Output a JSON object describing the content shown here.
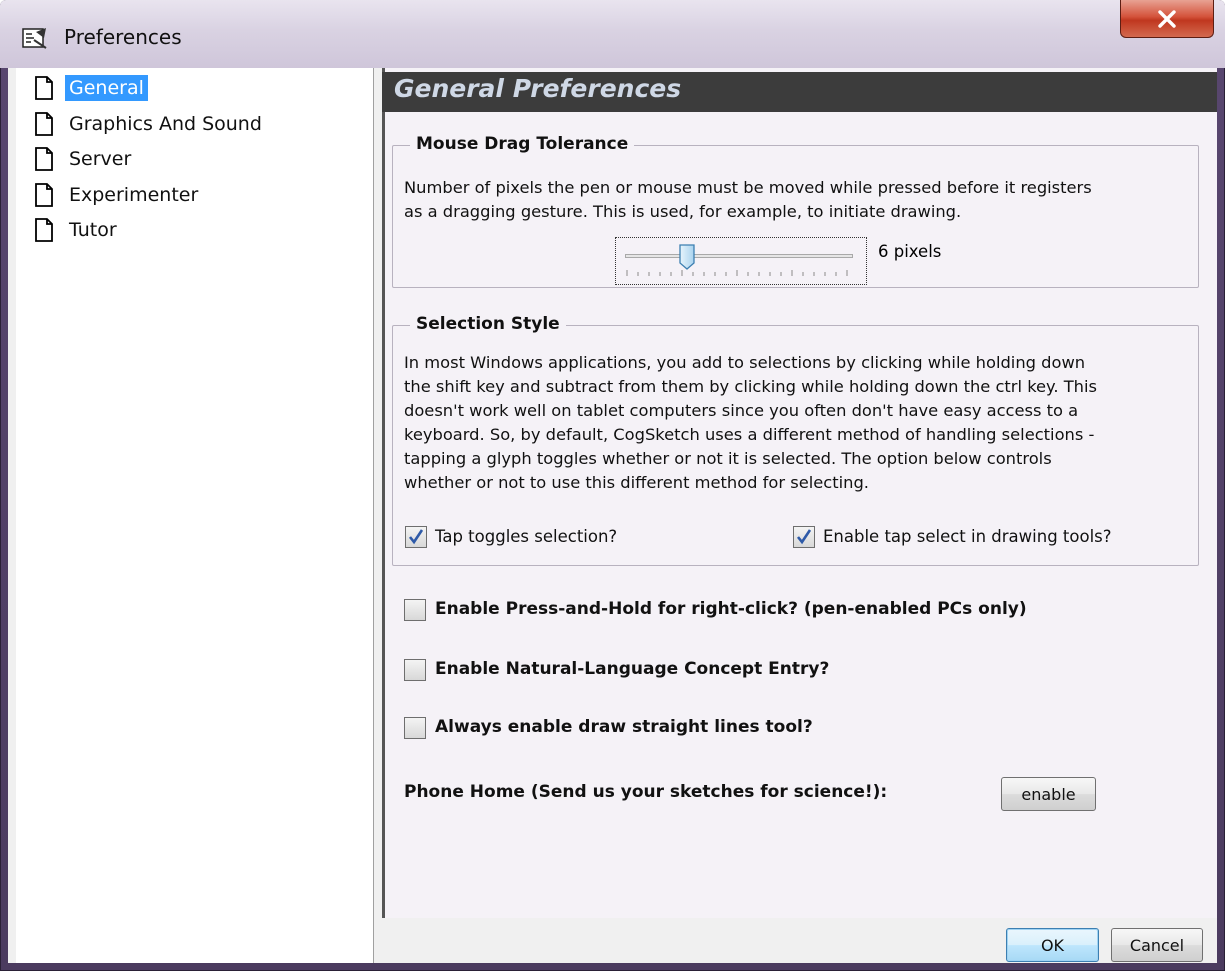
{
  "window": {
    "title": "Preferences"
  },
  "tree": {
    "items": [
      {
        "label": "General",
        "selected": true
      },
      {
        "label": "Graphics And Sound",
        "selected": false
      },
      {
        "label": "Server",
        "selected": false
      },
      {
        "label": "Experimenter",
        "selected": false
      },
      {
        "label": "Tutor",
        "selected": false
      }
    ]
  },
  "panel": {
    "title": "General Preferences",
    "mouse_drag": {
      "title": "Mouse Drag Tolerance",
      "description_line1": "Number of pixels the pen or mouse must be moved while pressed before it registers",
      "description_line2": "as a dragging gesture. This is used, for example, to initiate drawing.",
      "slider_value": 6,
      "slider_label": "6 pixels"
    },
    "selection_style": {
      "title": "Selection Style",
      "lines": [
        "In most Windows applications, you add to selections by clicking while holding down",
        "the shift key and subtract from them by clicking while holding down the ctrl key. This",
        "doesn't work well on tablet computers since you often don't have easy access to a",
        "keyboard.  So, by default, CogSketch uses a different method of handling selections -",
        "tapping a glyph toggles whether or not it is selected.  The option below controls",
        "whether or not to use this different method for selecting."
      ],
      "tap_toggles": {
        "label": "Tap toggles selection?",
        "checked": true
      },
      "tap_select_drawing": {
        "label": "Enable tap select in drawing tools?",
        "checked": true
      }
    },
    "press_hold": {
      "label": "Enable Press-and-Hold for right-click? (pen-enabled PCs only)",
      "checked": false
    },
    "natural_language": {
      "label": "Enable Natural-Language Concept Entry?",
      "checked": false
    },
    "straight_lines": {
      "label": "Always enable draw straight lines tool?",
      "checked": false
    },
    "phone_home": {
      "label": "Phone Home (Send us your sketches for science!):",
      "button": "enable"
    }
  },
  "buttons": {
    "ok": "OK",
    "cancel": "Cancel"
  },
  "icons": {
    "app": "preferences-app-icon",
    "close": "close-icon",
    "document": "document-icon",
    "check": "check-icon"
  },
  "colors": {
    "selection": "#3399ff",
    "header_bg": "#3c3c3c",
    "header_text": "#cfd8e6",
    "close_button": "#c0371f",
    "window_frame": "#58466f"
  }
}
